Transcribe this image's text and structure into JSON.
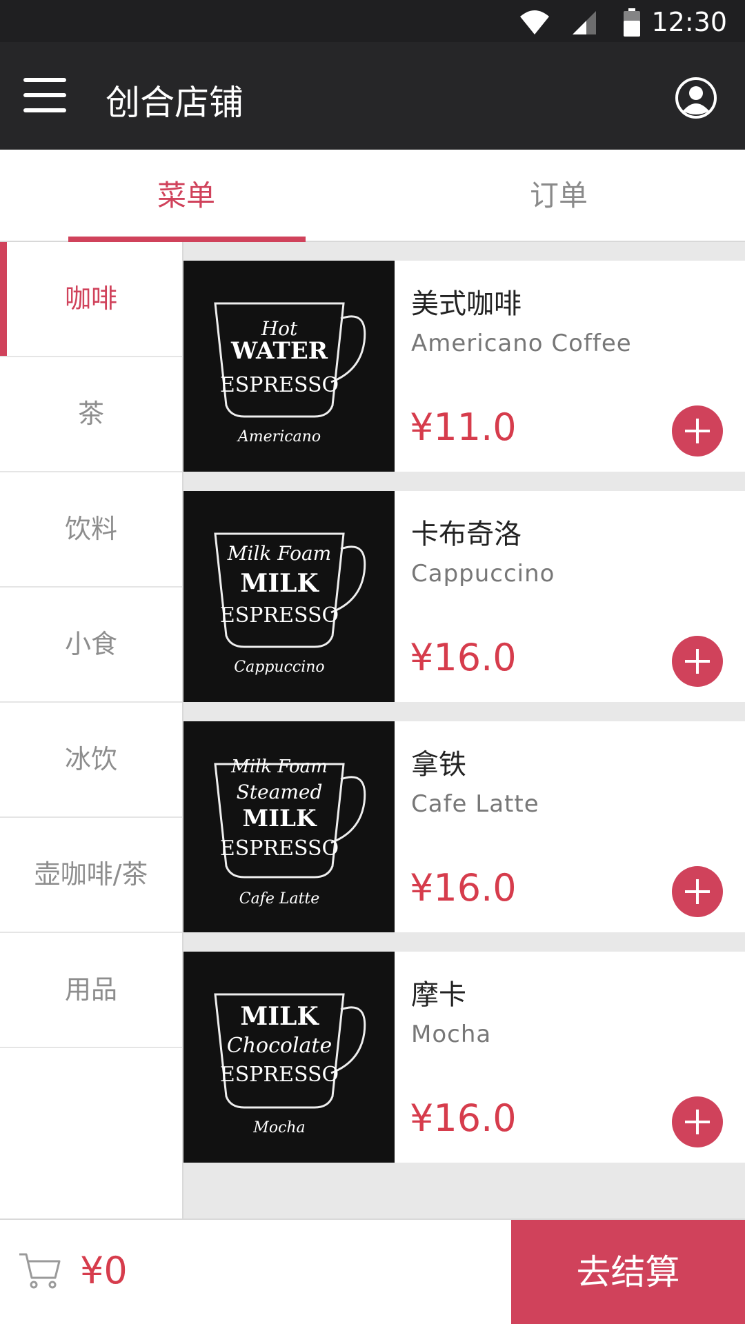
{
  "status_bar": {
    "time": "12:30"
  },
  "app_bar": {
    "title": "创合店铺"
  },
  "tabs": [
    {
      "label": "菜单",
      "active": true
    },
    {
      "label": "订单",
      "active": false
    }
  ],
  "categories": [
    {
      "label": "咖啡",
      "active": true
    },
    {
      "label": "茶"
    },
    {
      "label": "饮料"
    },
    {
      "label": "小食"
    },
    {
      "label": "冰饮"
    },
    {
      "label": "壶咖啡/茶"
    },
    {
      "label": "用品"
    }
  ],
  "products": [
    {
      "name_cn": "美式咖啡",
      "name_en": "Americano Coffee",
      "price": "¥11.0",
      "image_text": [
        "Hot",
        "WATER",
        "ESPRESSO",
        "Americano"
      ]
    },
    {
      "name_cn": "卡布奇洛",
      "name_en": "Cappuccino",
      "price": "¥16.0",
      "image_text": [
        "Milk Foam",
        "MILK",
        "ESPRESSO",
        "Cappuccino"
      ]
    },
    {
      "name_cn": "拿铁",
      "name_en": "Cafe Latte",
      "price": "¥16.0",
      "image_text": [
        "Milk Foam",
        "Steamed",
        "MILK",
        "ESPRESSO",
        "Cafe Latte"
      ]
    },
    {
      "name_cn": "摩卡",
      "name_en": "Mocha",
      "price": "¥16.0",
      "image_text": [
        "MILK",
        "Chocolate",
        "ESPRESSO",
        "Mocha"
      ]
    }
  ],
  "cart": {
    "total": "¥0",
    "checkout_label": "去结算"
  },
  "colors": {
    "accent": "#d0425b",
    "price": "#d63c4c",
    "app_bar": "#262628",
    "status_bar": "#1f1f21"
  },
  "icons": [
    "wifi-icon",
    "signal-icon",
    "battery-icon",
    "menu-icon",
    "profile-icon",
    "cart-icon",
    "plus-icon"
  ]
}
